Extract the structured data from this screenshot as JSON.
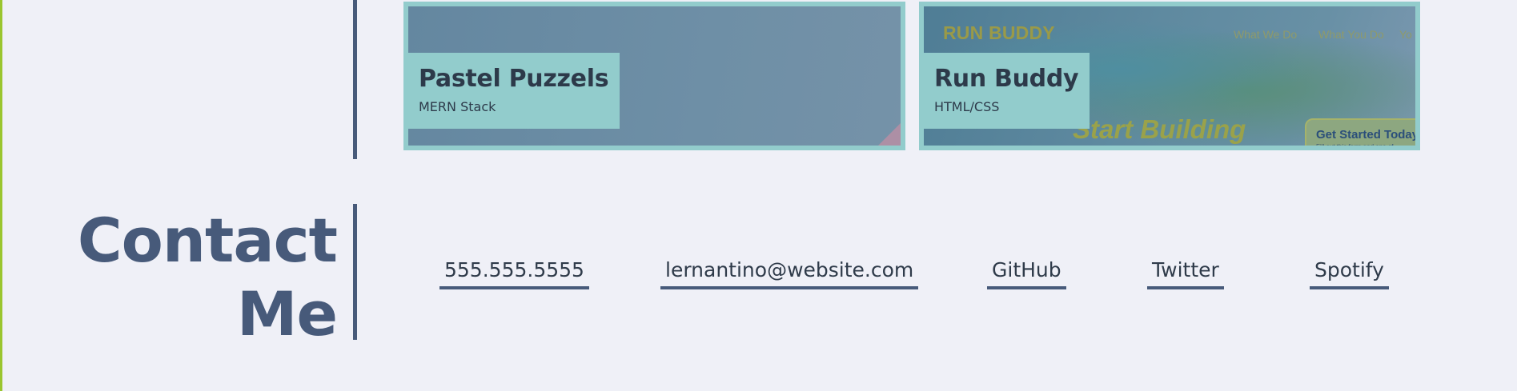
{
  "projects": [
    {
      "title": "Pastel Puzzels",
      "subtitle": "MERN Stack"
    },
    {
      "title": "Run Buddy",
      "subtitle": "HTML/CSS",
      "preview": {
        "logo": "RUN BUDDY",
        "nav": [
          "What We Do",
          "What You Do",
          "Yo"
        ],
        "hero": "Start Building",
        "cta_title": "Get Started Today",
        "cta_sub": "Fill out this form and one of"
      }
    }
  ],
  "contact": {
    "heading_line1": "Contact",
    "heading_line2": "Me",
    "links": [
      {
        "label": "555.555.5555"
      },
      {
        "label": "lernantino@website.com"
      },
      {
        "label": "GitHub"
      },
      {
        "label": "Twitter"
      },
      {
        "label": "Spotify"
      }
    ]
  },
  "colors": {
    "background": "#eff0f7",
    "accent_green": "#9ac52f",
    "primary_navy": "#475a7a",
    "card_teal": "#92cccc"
  }
}
